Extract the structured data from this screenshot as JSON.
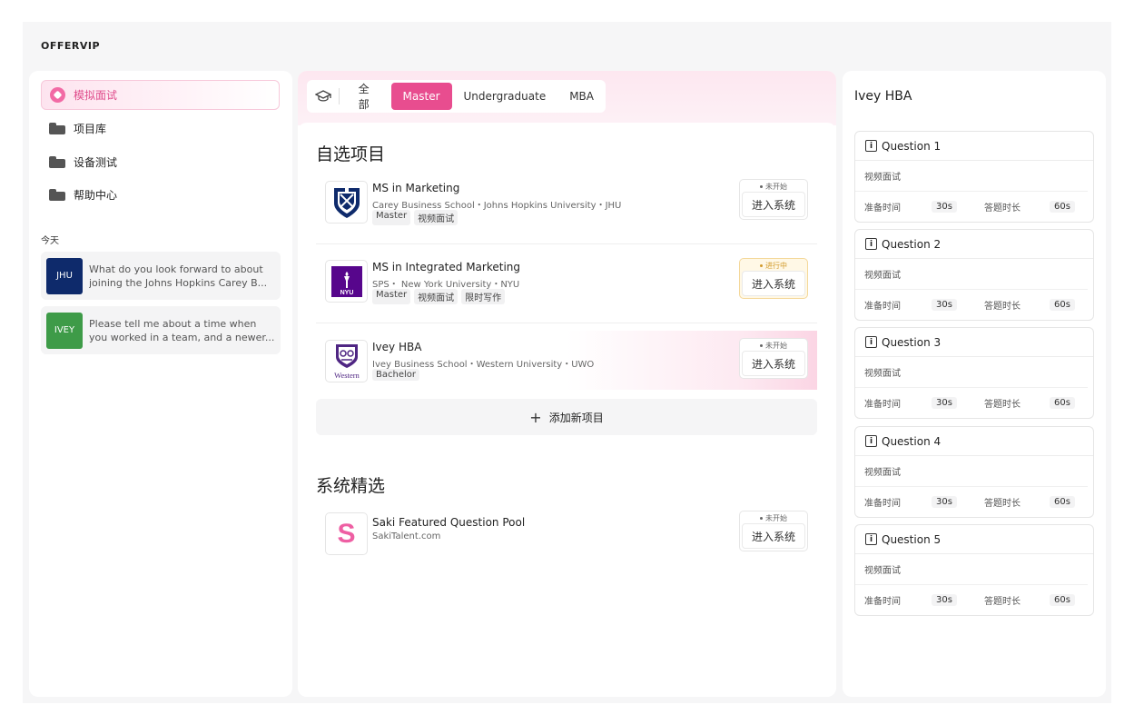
{
  "brand": "OFFERVIP",
  "sidebar": {
    "nav": [
      {
        "label": "模拟面试",
        "icon": "compass-icon",
        "active": true
      },
      {
        "label": "项目库",
        "icon": "folder-icon"
      },
      {
        "label": "设备测试",
        "icon": "folder-icon"
      },
      {
        "label": "帮助中心",
        "icon": "folder-icon"
      }
    ],
    "today_label": "今天",
    "history": [
      {
        "badge": "JHU",
        "badge_color": "#0e2a6b",
        "line1": "What do you look forward to about",
        "line2": "joining the Johns Hopkins Carey B..."
      },
      {
        "badge": "IVEY",
        "badge_color": "#3e9b48",
        "line1": "Please tell me about a time when",
        "line2": "you worked in a team, and a newer..."
      }
    ]
  },
  "tabs": {
    "items": [
      "全部",
      "Master",
      "Undergraduate",
      "MBA"
    ],
    "active": "Master"
  },
  "middle": {
    "section1_title": "自选项目",
    "projects": [
      {
        "title": "MS in Marketing",
        "sub": "Carey Business School・Johns Hopkins University・JHU",
        "tags": [
          "Master",
          "视频面试"
        ],
        "status": "未开始",
        "status_type": "idle",
        "button": "进入系统",
        "logo": "jhu-shield-logo"
      },
      {
        "title": "MS in Integrated Marketing",
        "sub": "SPS・ New York University・NYU",
        "tags": [
          "Master",
          "视频面试",
          "限时写作"
        ],
        "status": "进行中",
        "status_type": "progress",
        "button": "进入系统",
        "logo": "nyu-torch-logo"
      },
      {
        "title": "Ivey HBA",
        "sub": "Ivey Business School・Western University・UWO",
        "tags": [
          "Bachelor"
        ],
        "status": "未开始",
        "status_type": "idle",
        "button": "进入系统",
        "logo": "western-crest-logo"
      }
    ],
    "add_label": "添加新项目",
    "section2_title": "系统精选",
    "featured": {
      "title": "Saki Featured Question Pool",
      "sub": "SakiTalent.com",
      "status": "未开始",
      "button": "进入系统",
      "logo_letter": "S"
    }
  },
  "right": {
    "title": "Ivey HBA",
    "questions": [
      {
        "title": "Question 1",
        "type": "视频面试",
        "prep_label": "准备时间",
        "prep": "30s",
        "answer_label": "答题时长",
        "answer": "60s"
      },
      {
        "title": "Question 2",
        "type": "视频面试",
        "prep_label": "准备时间",
        "prep": "30s",
        "answer_label": "答题时长",
        "answer": "60s"
      },
      {
        "title": "Question 3",
        "type": "视频面试",
        "prep_label": "准备时间",
        "prep": "30s",
        "answer_label": "答题时长",
        "answer": "60s"
      },
      {
        "title": "Question 4",
        "type": "视频面试",
        "prep_label": "准备时间",
        "prep": "30s",
        "answer_label": "答题时长",
        "answer": "60s"
      },
      {
        "title": "Question 5",
        "type": "视频面试",
        "prep_label": "准备时间",
        "prep": "30s",
        "answer_label": "答题时长",
        "answer": "60s"
      }
    ]
  },
  "colors": {
    "accent": "#e84d8f",
    "progress": "#d29a2a"
  }
}
